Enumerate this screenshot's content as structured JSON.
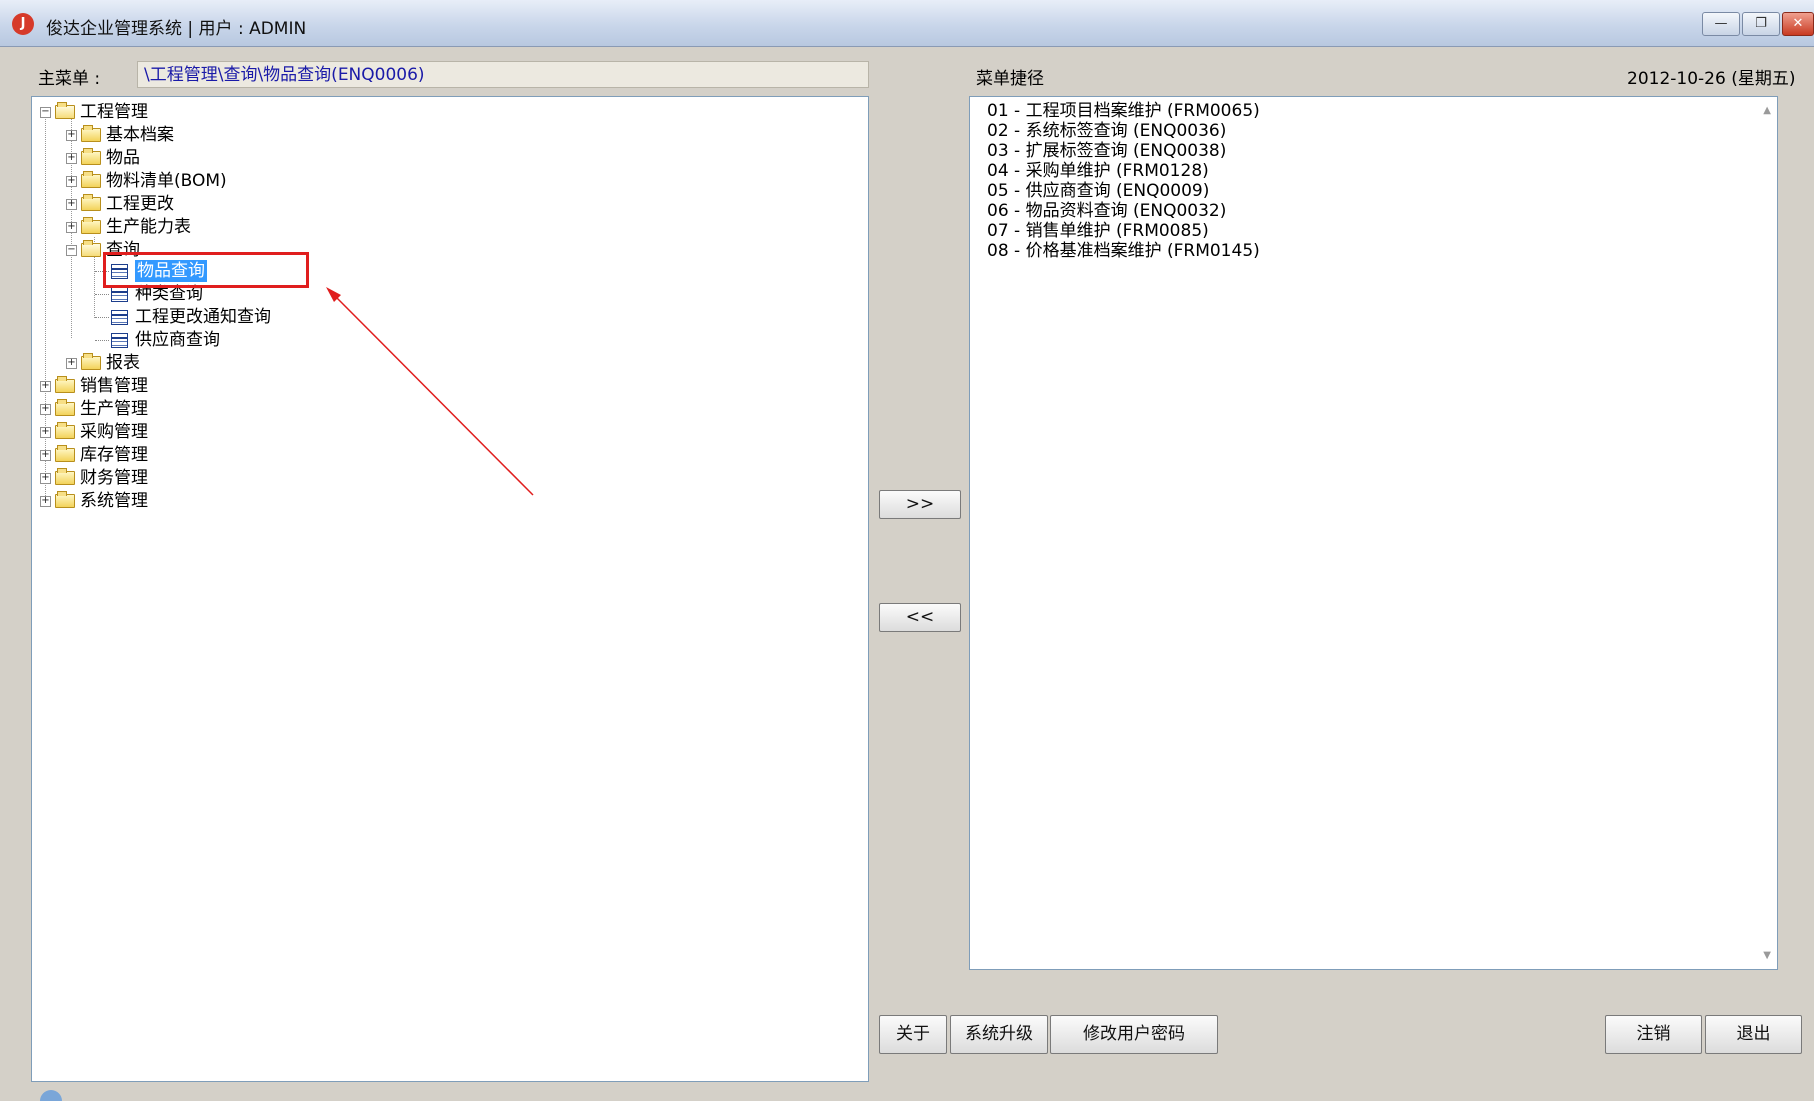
{
  "window": {
    "title": "俊达企业管理系统 | 用户 : ADMIN",
    "icon": "app-logo-icon",
    "controls": {
      "minimize": "—",
      "restore": "❐",
      "close": "✕"
    }
  },
  "main_menu": {
    "label": "主菜单 :",
    "path": "\\工程管理\\查询\\物品查询(ENQ0006)"
  },
  "tree": {
    "root": "工程管理",
    "root_children": [
      "基本档案",
      "物品",
      "物料清单(BOM)",
      "工程更改",
      "生产能力表"
    ],
    "query_folder": "查询",
    "query_items": [
      "物品查询",
      "种类查询",
      "工程更改通知查询",
      "供应商查询"
    ],
    "report_folder": "报表",
    "top_level": [
      "销售管理",
      "生产管理",
      "采购管理",
      "库存管理",
      "财务管理",
      "系统管理"
    ],
    "selected": "物品查询"
  },
  "shortcuts": {
    "label": "菜单捷径",
    "date": "2012-10-26 (星期五)",
    "items": [
      "01 - 工程项目档案维护 (FRM0065)",
      "02 - 系统标签查询 (ENQ0036)",
      "03 - 扩展标签查询 (ENQ0038)",
      "04 - 采购单维护 (FRM0128)",
      "05 - 供应商查询 (ENQ0009)",
      "06 - 物品资料查询 (ENQ0032)",
      "07 - 销售单维护 (FRM0085)",
      "08 - 价格基准档案维护 (FRM0145)"
    ]
  },
  "buttons": {
    "add": ">>",
    "remove": "<<",
    "about": "关于",
    "upgrade": "系统升级",
    "change_password": "修改用户密码",
    "logout": "注销",
    "exit": "退出"
  },
  "colors": {
    "highlight": "#e01e1e",
    "selection": "#3399ff",
    "path_text": "#1a1aa8"
  }
}
